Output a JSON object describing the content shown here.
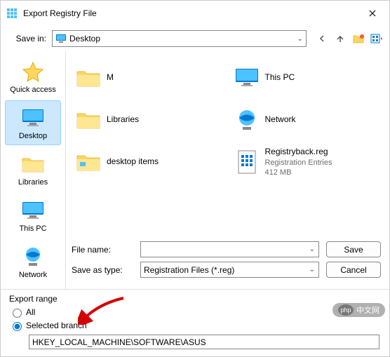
{
  "title": "Export Registry File",
  "saveInLabel": "Save in:",
  "saveInValue": "Desktop",
  "sidebar": [
    {
      "label": "Quick access"
    },
    {
      "label": "Desktop"
    },
    {
      "label": "Libraries"
    },
    {
      "label": "This PC"
    },
    {
      "label": "Network"
    }
  ],
  "files": [
    {
      "name": "M",
      "type": "folder"
    },
    {
      "name": "This PC",
      "type": "pc"
    },
    {
      "name": "Libraries",
      "type": "folder"
    },
    {
      "name": "Network",
      "type": "network"
    },
    {
      "name": "desktop items",
      "type": "folder"
    },
    {
      "name": "Registryback.reg",
      "type": "reg",
      "sub1": "Registration Entries",
      "sub2": "412 MB"
    }
  ],
  "fileNameLabel": "File name:",
  "fileNameValue": "",
  "saveTypeLabel": "Save as type:",
  "saveTypeValue": "Registration Files (*.reg)",
  "saveBtn": "Save",
  "cancelBtn": "Cancel",
  "exportRangeLabel": "Export range",
  "allLabel": "All",
  "selectedBranchLabel": "Selected branch",
  "selectedRadio": "selected",
  "branchPath": "HKEY_LOCAL_MACHINE\\SOFTWARE\\ASUS",
  "watermark": "中文网"
}
